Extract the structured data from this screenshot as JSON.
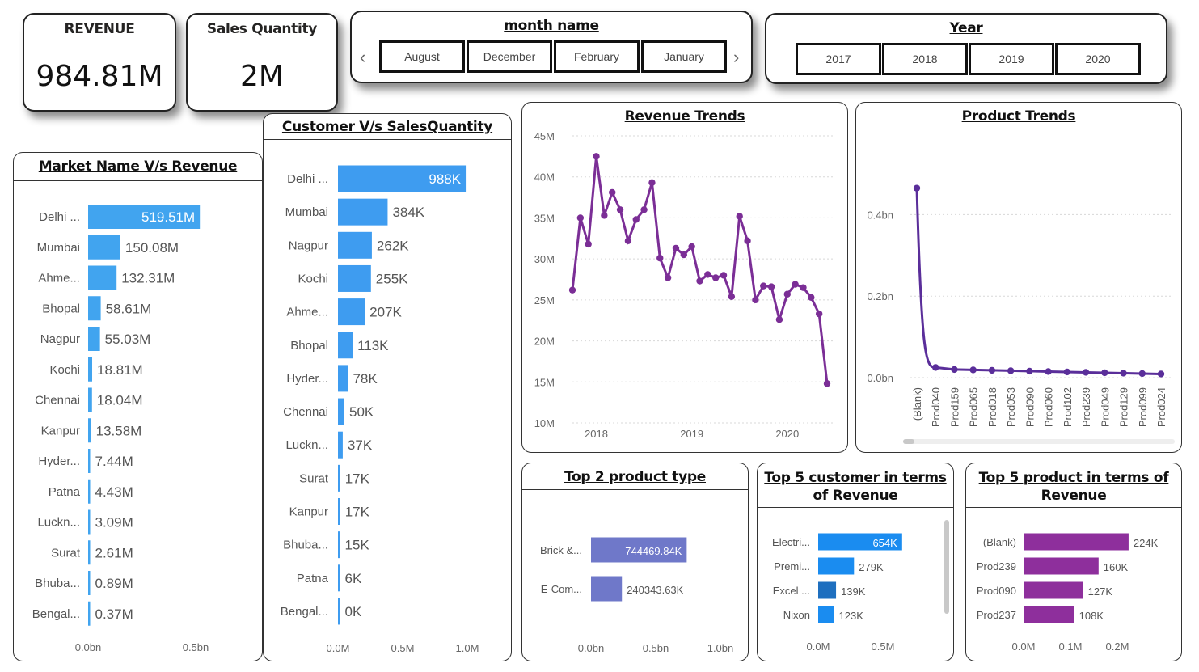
{
  "kpis": {
    "revenue_title": "REVENUE",
    "revenue_value": "984.81M",
    "qty_title": "Sales Quantity",
    "qty_value": "2M"
  },
  "month_slicer": {
    "title": "month name",
    "items": [
      "August",
      "December",
      "February",
      "January"
    ]
  },
  "year_slicer": {
    "title": "Year",
    "items": [
      "2017",
      "2018",
      "2019",
      "2020"
    ]
  },
  "colors": {
    "light_blue": "#41a4ef",
    "blue": "#3e9cf0",
    "purple_line": "#7b2e96",
    "dark_purple": "#5a2e9a",
    "periwinkle": "#6f78c9",
    "magenta": "#8e2f9c",
    "bright_blue": "#1a8cf0",
    "dark_blue": "#1e6fbf"
  },
  "charts": {
    "market_title": "Market Name V/s Revenue",
    "customer_title": "Customer V/s SalesQuantity",
    "revenue_trend_title": "Revenue Trends",
    "product_trend_title": "Product Trends",
    "top2_title": "Top 2 product type",
    "top5c_title": "Top 5 customer in terms of Revenue",
    "top5p_title": "Top 5 product in terms of Revenue"
  },
  "chart_data": [
    {
      "id": "market",
      "type": "bar",
      "title": "Market Name V/s Revenue",
      "categories": [
        "Delhi ...",
        "Mumbai",
        "Ahme...",
        "Bhopal",
        "Nagpur",
        "Kochi",
        "Chennai",
        "Kanpur",
        "Hyder...",
        "Patna",
        "Luckn...",
        "Surat",
        "Bhuba...",
        "Bengal..."
      ],
      "values": [
        519.51,
        150.08,
        132.31,
        58.61,
        55.03,
        18.81,
        18.04,
        13.58,
        7.44,
        4.43,
        3.09,
        2.61,
        0.89,
        0.37
      ],
      "labels": [
        "519.51M",
        "150.08M",
        "132.31M",
        "58.61M",
        "55.03M",
        "18.81M",
        "18.04M",
        "13.58M",
        "7.44M",
        "4.43M",
        "3.09M",
        "2.61M",
        "0.89M",
        "0.37M"
      ],
      "xticks": [
        "0.0bn",
        "0.5bn"
      ],
      "xlim": [
        0,
        1000
      ]
    },
    {
      "id": "customer",
      "type": "bar",
      "title": "Customer V/s SalesQuantity",
      "categories": [
        "Delhi ...",
        "Mumbai",
        "Nagpur",
        "Kochi",
        "Ahme...",
        "Bhopal",
        "Hyder...",
        "Chennai",
        "Luckn...",
        "Surat",
        "Kanpur",
        "Bhuba...",
        "Patna",
        "Bengal..."
      ],
      "values": [
        988,
        384,
        262,
        255,
        207,
        113,
        78,
        50,
        37,
        17,
        17,
        15,
        6,
        0
      ],
      "labels": [
        "988K",
        "384K",
        "262K",
        "255K",
        "207K",
        "113K",
        "78K",
        "50K",
        "37K",
        "17K",
        "17K",
        "15K",
        "6K",
        "0K"
      ],
      "xticks": [
        "0.0M",
        "0.5M",
        "1.0M"
      ],
      "xlim": [
        0,
        1000
      ]
    },
    {
      "id": "revenue_trend",
      "type": "line",
      "title": "Revenue Trends",
      "x": [
        "2017-10",
        "2017-11",
        "2017-12",
        "2018-01",
        "2018-02",
        "2018-03",
        "2018-04",
        "2018-05",
        "2018-06",
        "2018-07",
        "2018-08",
        "2018-09",
        "2018-10",
        "2018-11",
        "2018-12",
        "2019-01",
        "2019-02",
        "2019-03",
        "2019-04",
        "2019-05",
        "2019-06",
        "2019-07",
        "2019-08",
        "2019-09",
        "2019-10",
        "2019-11",
        "2019-12",
        "2020-01",
        "2020-02",
        "2020-03",
        "2020-04",
        "2020-05",
        "2020-06"
      ],
      "values": [
        26.2,
        35.0,
        31.8,
        42.5,
        35.3,
        38.1,
        36.0,
        32.2,
        34.8,
        36.0,
        39.3,
        30.1,
        27.7,
        31.3,
        30.5,
        31.5,
        27.3,
        28.1,
        27.7,
        28.0,
        25.4,
        35.2,
        32.2,
        25.0,
        26.7,
        26.6,
        22.6,
        25.7,
        26.9,
        26.5,
        25.3,
        23.3,
        14.8
      ],
      "yticks": [
        "10M",
        "15M",
        "20M",
        "25M",
        "30M",
        "35M",
        "40M",
        "45M"
      ],
      "xticks": [
        "2018",
        "2019",
        "2020"
      ],
      "ylim": [
        10,
        45
      ]
    },
    {
      "id": "product_trend",
      "type": "line",
      "title": "Product Trends",
      "categories": [
        "(Blank)",
        "Prod040",
        "Prod159",
        "Prod065",
        "Prod018",
        "Prod053",
        "Prod090",
        "Prod060",
        "Prod102",
        "Prod239",
        "Prod049",
        "Prod129",
        "Prod099",
        "Prod024"
      ],
      "values": [
        0.465,
        0.025,
        0.02,
        0.019,
        0.018,
        0.017,
        0.016,
        0.015,
        0.014,
        0.013,
        0.012,
        0.011,
        0.01,
        0.009
      ],
      "yticks": [
        "0.0bn",
        "0.2bn",
        "0.4bn"
      ],
      "ylim": [
        0,
        0.5
      ]
    },
    {
      "id": "top2",
      "type": "bar",
      "title": "Top 2 product type",
      "categories": [
        "Brick &...",
        "E-Com..."
      ],
      "values": [
        744469.84,
        240343.63
      ],
      "labels": [
        "744469.84K",
        "240343.63K"
      ],
      "xticks": [
        "0.0bn",
        "0.5bn",
        "1.0bn"
      ],
      "xlim": [
        0,
        1000000
      ]
    },
    {
      "id": "top5c",
      "type": "bar",
      "title": "Top 5 customer in terms of Revenue",
      "categories": [
        "Electri...",
        "Premi...",
        "Excel ...",
        "Nixon"
      ],
      "values": [
        654,
        279,
        139,
        123
      ],
      "labels": [
        "654K",
        "279K",
        "139K",
        "123K"
      ],
      "xticks": [
        "0.0M",
        "0.5M"
      ],
      "xlim": [
        0,
        800
      ]
    },
    {
      "id": "top5p",
      "type": "bar",
      "title": "Top 5 product in terms of Revenue",
      "categories": [
        "(Blank)",
        "Prod239",
        "Prod090",
        "Prod237"
      ],
      "values": [
        224,
        160,
        127,
        108
      ],
      "labels": [
        "224K",
        "160K",
        "127K",
        "108K"
      ],
      "xticks": [
        "0.0M",
        "0.1M",
        "0.2M"
      ],
      "xlim": [
        0,
        250
      ]
    }
  ]
}
